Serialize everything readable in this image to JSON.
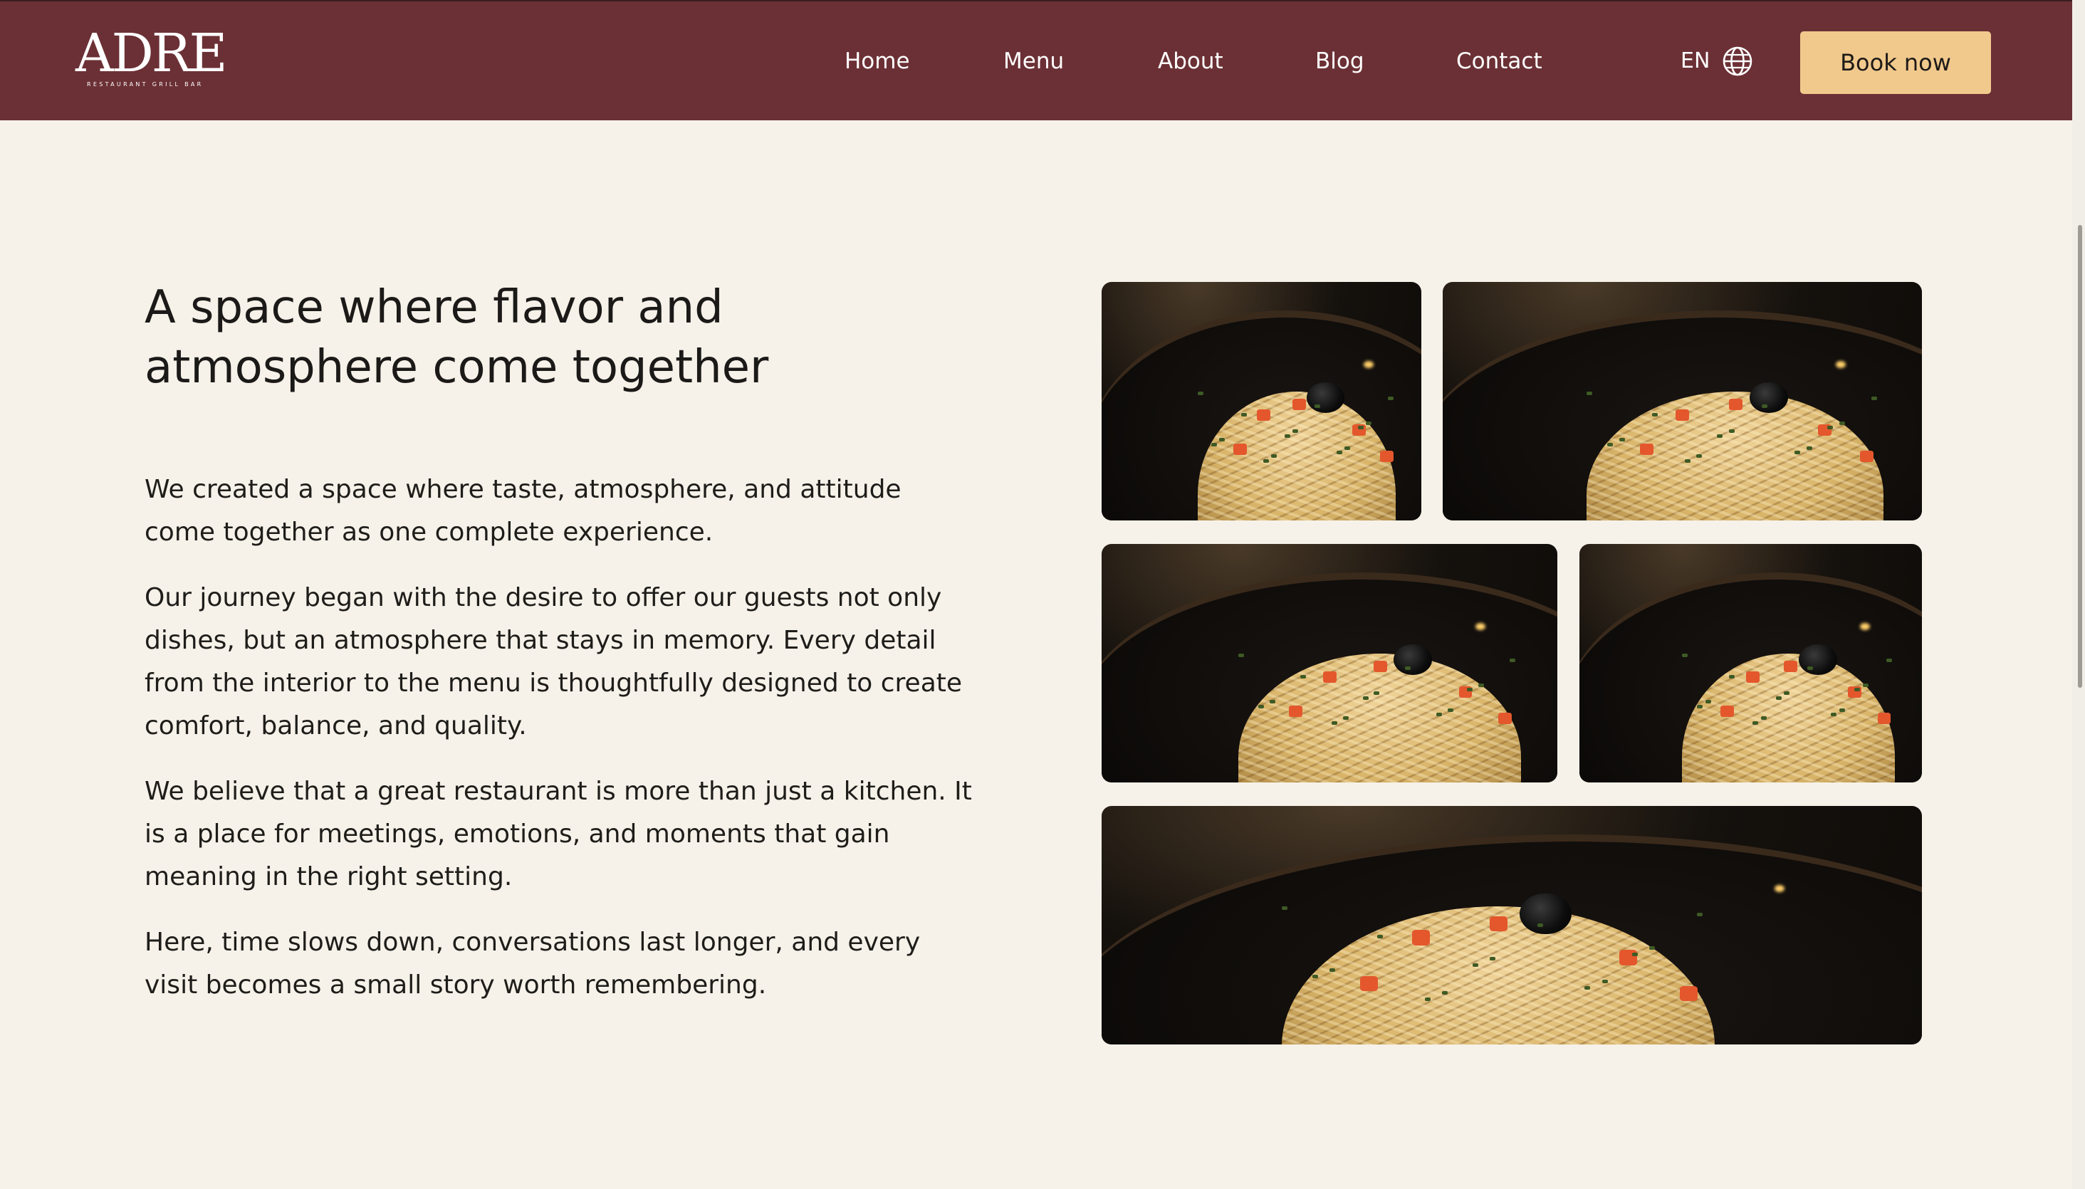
{
  "header": {
    "logo": {
      "name": "ADRE",
      "tagline": "RESTAURANT GRILL BAR"
    },
    "nav": [
      {
        "label": "Home"
      },
      {
        "label": "Menu"
      },
      {
        "label": "About"
      },
      {
        "label": "Blog"
      },
      {
        "label": "Contact"
      }
    ],
    "language": {
      "label": "EN",
      "icon": "globe-icon"
    },
    "cta_label": "Book now"
  },
  "main": {
    "title_line1": "A space where flavor and",
    "title_line2": "atmosphere come together",
    "paragraphs": [
      "We created a space where taste, atmosphere, and attitude come together as one complete experience.",
      "Our journey began with the desire to offer our guests not only dishes, but an atmosphere that stays in memory. Every detail from the interior to the menu is thoughtfully designed to create comfort, balance, and quality.",
      "We believe that a great restaurant is more than just a kitchen. It is a place for meetings, emotions, and moments that gain meaning in the right setting.",
      "Here, time slows down, conversations last longer, and every visit becomes a small story worth remembering."
    ],
    "gallery_count": 5
  },
  "colors": {
    "header_bg": "#6b3035",
    "page_bg": "#f6f2e9",
    "cta_bg": "#f1c98d",
    "text": "#1c1a18"
  }
}
